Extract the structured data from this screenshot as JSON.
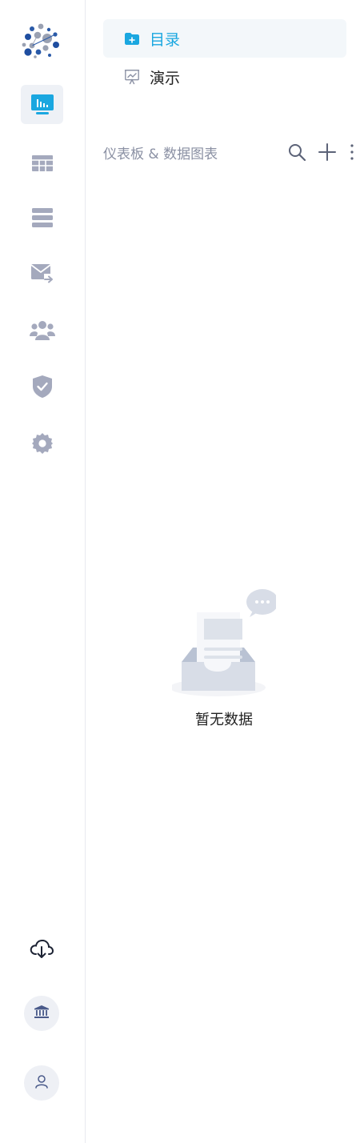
{
  "sidebar": {
    "logo_icon": "org-network-logo",
    "items": [
      {
        "name": "dashboard",
        "icon": "dashboard-chart-icon",
        "active": true
      },
      {
        "name": "table",
        "icon": "table-grid-icon",
        "active": false
      },
      {
        "name": "list",
        "icon": "list-stack-icon",
        "active": false
      },
      {
        "name": "mail",
        "icon": "mail-forward-icon",
        "active": false
      },
      {
        "name": "users",
        "icon": "users-group-icon",
        "active": false
      },
      {
        "name": "security",
        "icon": "shield-check-icon",
        "active": false
      },
      {
        "name": "settings",
        "icon": "gear-icon",
        "active": false
      }
    ],
    "bottom": [
      {
        "name": "download",
        "icon": "cloud-download-icon"
      },
      {
        "name": "institution",
        "icon": "bank-icon"
      },
      {
        "name": "account",
        "icon": "user-icon"
      }
    ]
  },
  "nav": {
    "catalog_label": "目录",
    "presentation_label": "演示"
  },
  "section": {
    "title": "仪表板 & 数据图表",
    "actions": [
      "search-icon",
      "plus-icon",
      "more-vertical-icon"
    ]
  },
  "empty_state": {
    "text": "暂无数据"
  },
  "colors": {
    "accent": "#1aa7e0",
    "icon_gray": "#a4a9bd",
    "active_bg": "#eef1f6"
  }
}
